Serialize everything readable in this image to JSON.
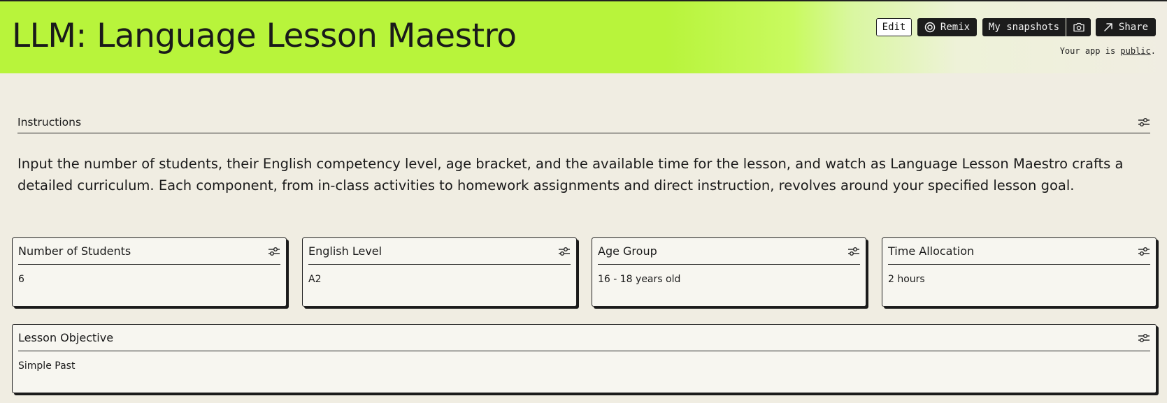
{
  "header": {
    "title": "LLM: Language Lesson Maestro",
    "edit_label": "Edit",
    "remix_label": "Remix",
    "snapshots_label": "My snapshots",
    "share_label": "Share",
    "status_prefix": "Your app is ",
    "status_link": "public",
    "status_suffix": ".",
    "accent_color": "#b8f43b"
  },
  "instructions": {
    "heading": "Instructions",
    "text": "Input the number of students, their English competency level, age bracket, and the available time for the lesson, and watch as Language Lesson Maestro crafts a detailed curriculum. Each component, from in-class activities to homework assignments and direct instruction, revolves around your specified lesson goal."
  },
  "inputs": [
    {
      "label": "Number of Students",
      "value": "6"
    },
    {
      "label": "English Level",
      "value": "A2"
    },
    {
      "label": "Age Group",
      "value": "16 - 18 years old"
    },
    {
      "label": "Time Allocation",
      "value": "2 hours"
    },
    {
      "label": "Lesson Objective",
      "value": "Simple Past"
    }
  ],
  "icons": {
    "remix": "remix-icon",
    "camera": "camera-icon",
    "share": "share-arrow-icon",
    "settings": "sliders-icon"
  }
}
